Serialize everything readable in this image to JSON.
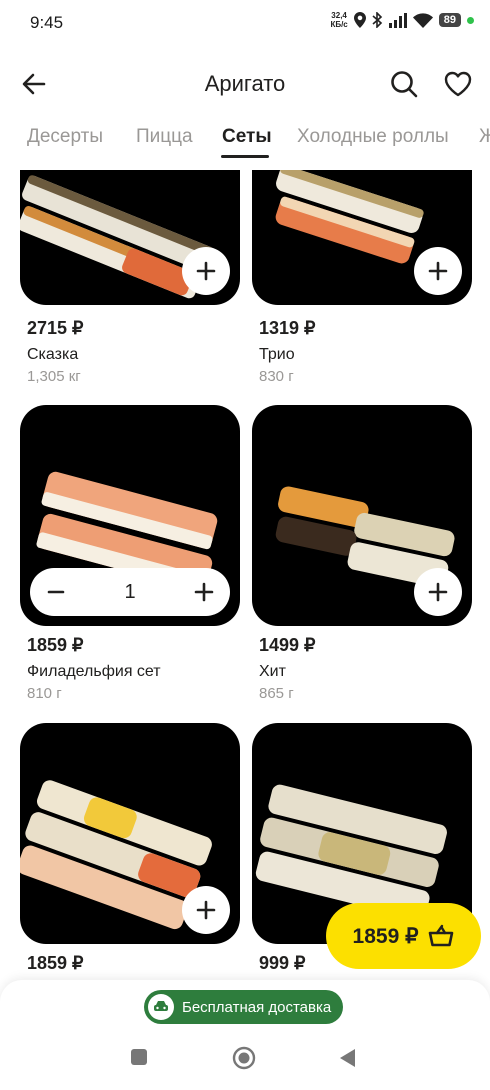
{
  "status_bar": {
    "time": "9:45",
    "net_speed_value": "32,4",
    "net_speed_unit": "КБ/с",
    "battery": "89"
  },
  "header": {
    "title": "Аригато"
  },
  "tabs": [
    {
      "label": "Десерты"
    },
    {
      "label": "Пицца"
    },
    {
      "label": "Сеты"
    },
    {
      "label": "Холодные роллы"
    },
    {
      "label": "Ж"
    }
  ],
  "products": [
    {
      "price": "2715 ₽",
      "name": "Сказка",
      "weight": "1,305 кг"
    },
    {
      "price": "1319 ₽",
      "name": "Трио",
      "weight": "830 г"
    },
    {
      "price": "1859 ₽",
      "name": "Филадельфия сет",
      "weight": "810 г",
      "quantity": "1"
    },
    {
      "price": "1499 ₽",
      "name": "Хит",
      "weight": "865 г"
    },
    {
      "price": "1859 ₽"
    },
    {
      "price": "999 ₽"
    }
  ],
  "cart": {
    "total": "1859 ₽"
  },
  "delivery": {
    "label": "Бесплатная доставка"
  },
  "colors": {
    "accent": "#fce000",
    "delivery_green": "#2e7d3d",
    "card_bg": "#000000"
  }
}
